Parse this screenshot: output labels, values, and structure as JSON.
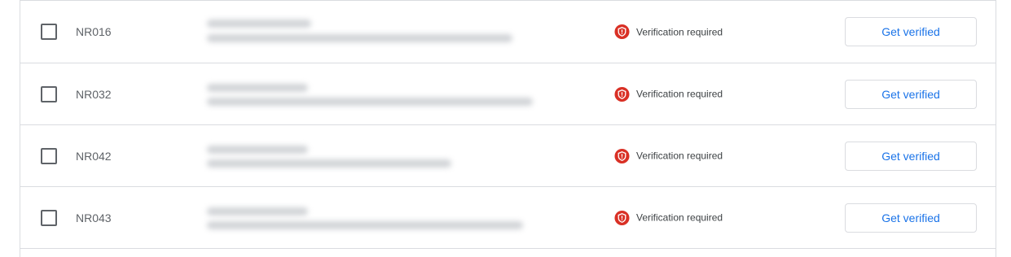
{
  "rows": [
    {
      "code": "NR016",
      "status": "Verification required",
      "action_label": "Get verified"
    },
    {
      "code": "NR032",
      "status": "Verification required",
      "action_label": "Get verified"
    },
    {
      "code": "NR042",
      "status": "Verification required",
      "action_label": "Get verified"
    },
    {
      "code": "NR043",
      "status": "Verification required",
      "action_label": "Get verified"
    }
  ],
  "colors": {
    "status_icon": "#d93025",
    "button_text": "#1a73e8",
    "border": "#dadce0"
  },
  "icons": {
    "status": "shield-alert-icon",
    "row_select": "checkbox"
  }
}
